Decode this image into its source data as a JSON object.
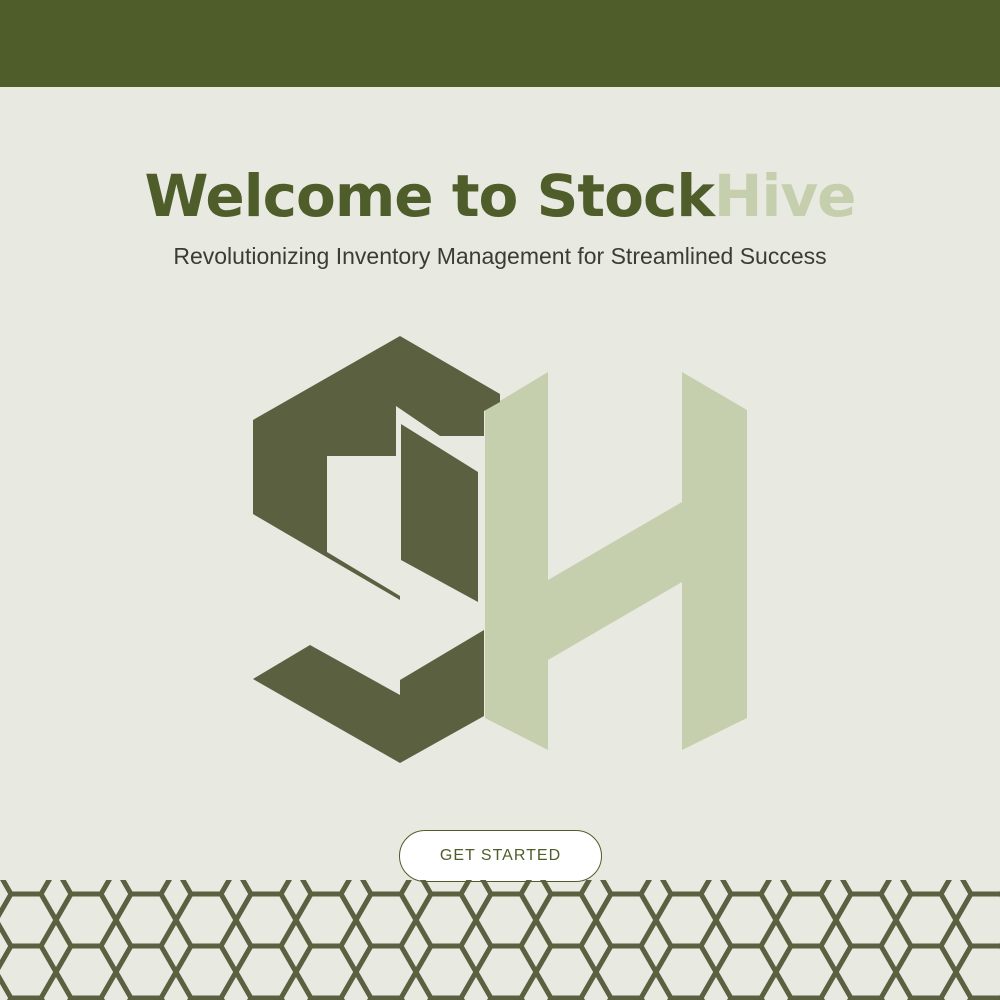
{
  "header": {
    "title_part_a": "Welcome to Stock",
    "title_part_b": "Hive",
    "subtitle": "Revolutionizing Inventory Management for Streamlined Success"
  },
  "logo": {
    "icon": "stockhive-sh-logo-icon",
    "letters": [
      "S",
      "H"
    ]
  },
  "cta": {
    "label": "GET STARTED"
  },
  "decoration": {
    "icon": "honeycomb-pattern-icon"
  },
  "colors": {
    "brand_dark": "#4f5d2a",
    "brand_light": "#c5cfad",
    "background": "#e8e9e1",
    "logo_dark": "#5a6040"
  }
}
